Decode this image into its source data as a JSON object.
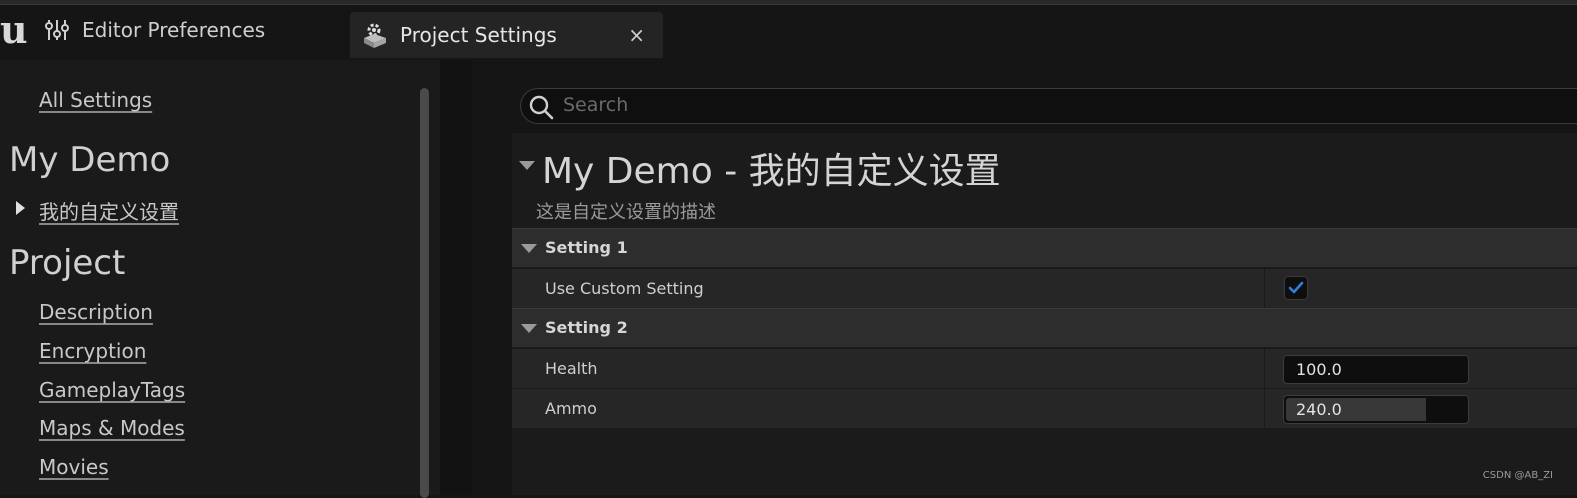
{
  "tabs": [
    {
      "label": "Editor Preferences",
      "icon": "sliders-icon"
    },
    {
      "label": "Project Settings",
      "icon": "gear-box-icon",
      "close": "×"
    }
  ],
  "sidebar": {
    "all_settings": "All Settings",
    "groups": [
      {
        "title": "My Demo",
        "items": [
          "我的自定义设置"
        ]
      },
      {
        "title": "Project",
        "items": [
          "Description",
          "Encryption",
          "GameplayTags",
          "Maps & Modes",
          "Movies"
        ]
      }
    ]
  },
  "search": {
    "placeholder": "Search"
  },
  "section": {
    "title": "My Demo - 我的自定义设置",
    "description": "这是自定义设置的描述"
  },
  "categories": [
    {
      "name": "Setting 1",
      "properties": [
        {
          "label": "Use Custom Setting",
          "checked": true
        }
      ]
    },
    {
      "name": "Setting 2",
      "properties": [
        {
          "label": "Health",
          "value": "100.0"
        },
        {
          "label": "Ammo",
          "value": "240.0",
          "fill_fraction": 0.77
        }
      ]
    }
  ],
  "watermark": "CSDN @AB_ZI",
  "colors": {
    "check_blue": "#2f7fe0",
    "background": "#151515",
    "panel": "#1b1b1b"
  }
}
